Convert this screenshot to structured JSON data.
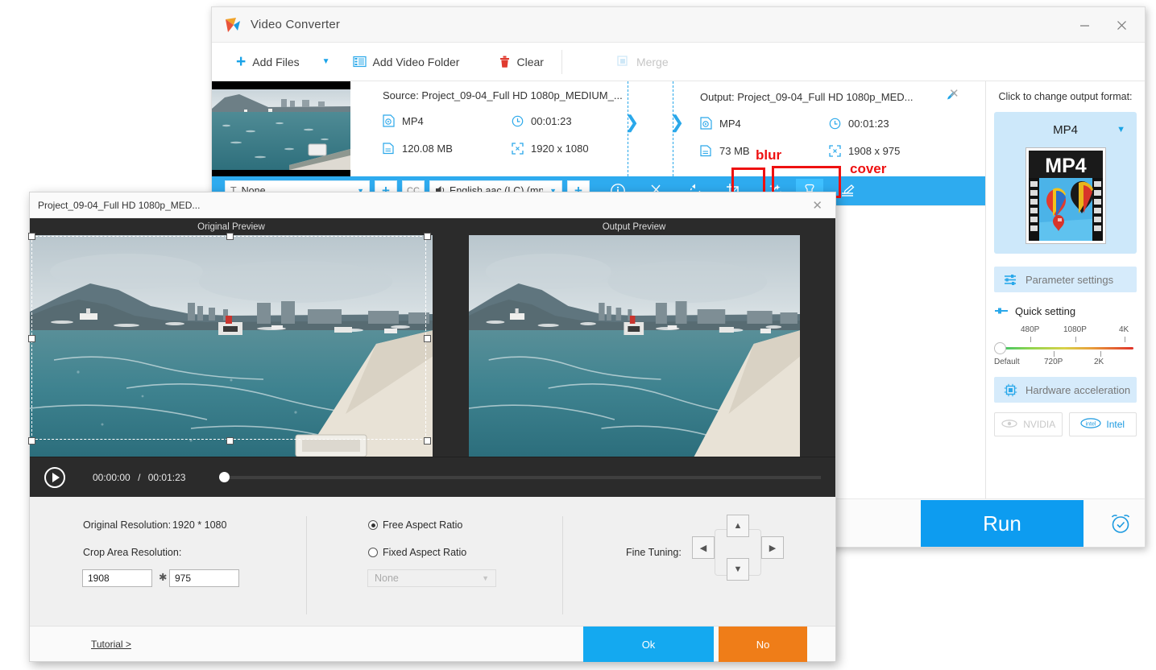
{
  "app": {
    "title": "Video Converter",
    "logo_icon": "play-triangle-logo",
    "minimize_label": "–",
    "close_label": "✕"
  },
  "toolbar": {
    "add_files": "Add Files",
    "add_files_icon": "plus-icon",
    "dropdown_icon": "chevron-down-icon",
    "add_video_folder": "Add Video Folder",
    "add_video_folder_icon": "folder-film-icon",
    "clear": "Clear",
    "clear_icon": "trash-icon",
    "merge": "Merge",
    "merge_icon": "merge-squares-icon"
  },
  "file_row": {
    "source": {
      "title": "Source: Project_09-04_Full HD 1080p_MEDIUM_...",
      "format": "MP4",
      "duration": "00:01:23",
      "size": "120.08 MB",
      "resolution": "1920 x 1080"
    },
    "output": {
      "title": "Output: Project_09-04_Full HD 1080p_MED...",
      "format": "MP4",
      "duration": "00:01:23",
      "size": "73 MB",
      "resolution": "1908 x 975",
      "edit_icon": "pencil-icon",
      "remove_icon": "close-icon"
    },
    "icons": {
      "format": "video-file-icon",
      "duration": "clock-icon",
      "size": "document-icon",
      "resolution": "resize-frame-icon"
    }
  },
  "action_bar": {
    "subtitle_value": "None",
    "subtitle_icon": "text-T-icon",
    "add_subtitle_label": "+",
    "cc_label": "CC",
    "audio_value": "English aac (LC) (mp",
    "audio_icon": "speaker-icon",
    "add_audio_label": "+",
    "tools": [
      {
        "name": "info-icon",
        "glyph": "i"
      },
      {
        "name": "cut-scissors-icon",
        "glyph": "✂"
      },
      {
        "name": "rotate-icon",
        "glyph": "↺"
      },
      {
        "name": "crop-icon",
        "glyph": "crop"
      },
      {
        "name": "effects-wand-icon",
        "glyph": "✨"
      },
      {
        "name": "watermark-stamp-icon",
        "glyph": "stamp"
      },
      {
        "name": "edit-lines-icon",
        "glyph": "✎"
      }
    ]
  },
  "annotations": {
    "blur": "blur",
    "cover": "cover",
    "color": "#ee1111"
  },
  "sidebar": {
    "change_format_label": "Click to change output format:",
    "format_name": "MP4",
    "format_caret_icon": "chevron-down-icon",
    "format_thumb_text": "MP4",
    "parameter_settings": "Parameter settings",
    "parameter_settings_icon": "sliders-icon",
    "quick_setting": "Quick setting",
    "quick_setting_icon": "slider-small-icon",
    "slider": {
      "ticks_top": [
        "480P",
        "1080P",
        "4K"
      ],
      "ticks_bottom": [
        "Default",
        "720P",
        "2K"
      ],
      "value": "Default"
    },
    "hardware_acceleration": "Hardware acceleration",
    "hardware_acceleration_icon": "cpu-chip-icon",
    "nvidia": "NVIDIA",
    "nvidia_icon": "nvidia-eye-icon",
    "intel": "Intel",
    "intel_icon": "intel-badge-icon"
  },
  "run_bar": {
    "run_label": "Run",
    "alarm_icon": "alarm-clock-icon"
  },
  "crop_dialog": {
    "title": "Project_09-04_Full HD 1080p_MED...",
    "close_icon": "close-icon",
    "original_preview_label": "Original Preview",
    "output_preview_label": "Output Preview",
    "player": {
      "play_icon": "play-circle-icon",
      "current_time": "00:00:00",
      "separator": "/",
      "total_time": "00:01:23"
    },
    "original_resolution_label": "Original Resolution:",
    "original_resolution_value": "1920 * 1080",
    "crop_area_label": "Crop Area Resolution:",
    "crop_width": "1908",
    "crop_multiply": "✱",
    "crop_height": "975",
    "free_aspect_ratio": "Free Aspect Ratio",
    "fixed_aspect_ratio": "Fixed Aspect Ratio",
    "selected_ratio_mode": "free",
    "ratio_select_value": "None",
    "ratio_select_caret": "chevron-down-icon",
    "fine_tuning_label": "Fine Tuning:",
    "fine_tuning": {
      "up": "▲",
      "down": "▼",
      "left": "◀",
      "right": "▶"
    },
    "tutorial": "Tutorial >",
    "ok": "Ok",
    "no": "No"
  }
}
